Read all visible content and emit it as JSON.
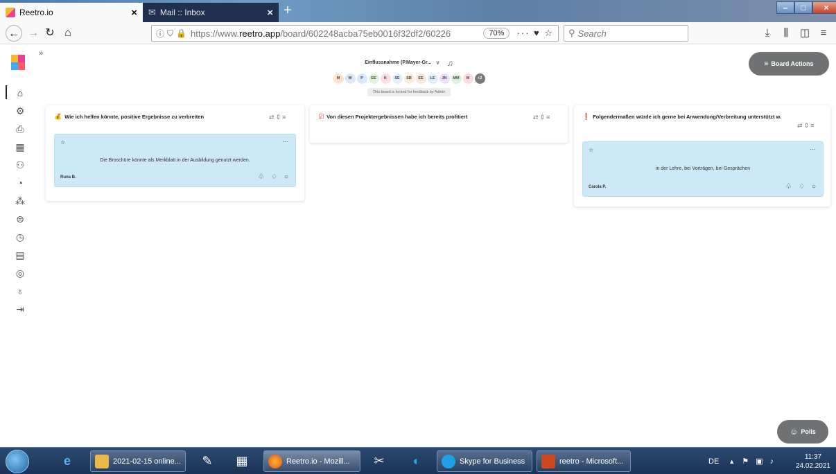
{
  "browser": {
    "tabs": [
      {
        "title": "Reetro.io",
        "active": true
      },
      {
        "title": "Mail :: Inbox",
        "active": false,
        "icon": "mail-icon"
      }
    ],
    "url_prefix": "https://www.",
    "url_domain": "reetro.app",
    "url_path": "/board/602248acba75eb0016f32df2/60226",
    "zoom": "70%",
    "search_placeholder": "Search",
    "url_extra": "··· ♥ ☆"
  },
  "board": {
    "title": "Einflussnahme (P.Mayer-Gr...",
    "locked_notice": "This board is locked for feedback by Admin",
    "board_actions_label": "Board Actions",
    "polls_label": "Polls",
    "members": [
      {
        "initials": "M",
        "color": "#fde2cf"
      },
      {
        "initials": "W",
        "color": "#dfe6f5"
      },
      {
        "initials": "P",
        "color": "#d7e9fb"
      },
      {
        "initials": "EE",
        "color": "#dff3d9"
      },
      {
        "initials": "K",
        "color": "#fbdde6"
      },
      {
        "initials": "SE",
        "color": "#e3f0fb"
      },
      {
        "initials": "SB",
        "color": "#fbeed9"
      },
      {
        "initials": "EE",
        "color": "#fbe5da"
      },
      {
        "initials": "LE",
        "color": "#e1ecf9"
      },
      {
        "initials": "JN",
        "color": "#e9e1f9"
      },
      {
        "initials": "MM",
        "color": "#dcf0df"
      },
      {
        "initials": "M",
        "color": "#fbdde0"
      },
      {
        "initials": "+2",
        "color": "#7a7d80"
      }
    ],
    "columns": [
      {
        "emoji": "💰",
        "title": "Wie ich helfen könnte, positive Ergebnisse zu verbreiten",
        "cards": [
          {
            "text": "Die Broschüre könnte als Merkblatt in der Ausbildung genutzt werden.",
            "author": "Runa B."
          }
        ]
      },
      {
        "emoji": "☑",
        "title": "Von diesen Projektergebnissen habe ich bereits profitiert",
        "cards": []
      },
      {
        "emoji": "❗",
        "title": "Folgendermaßen würde ich gerne bei Anwendung/Verbreitung unterstützt w.",
        "cards": [
          {
            "text": "in der Lehre, bei Vorträgen, bei Gesprächen",
            "author": "Carola P."
          }
        ]
      }
    ]
  },
  "taskbar": {
    "items": [
      {
        "label": "2021-02-15 online..."
      },
      {
        "label": "Reetro.io - Mozill..."
      },
      {
        "label": "Skype for Business"
      },
      {
        "label": "reetro - Microsoft..."
      }
    ],
    "language": "DE",
    "time": "11:37",
    "date": "24.02.2021"
  },
  "colors": {
    "card_bg": "#cde9f8",
    "pill_bg": "#6f7173"
  }
}
